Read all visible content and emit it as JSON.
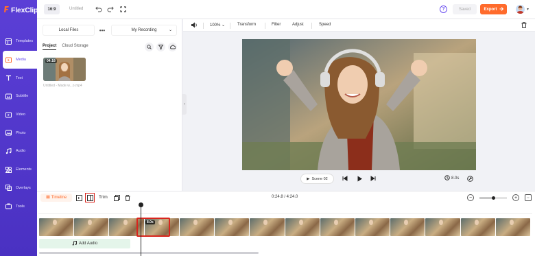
{
  "app": {
    "logo": "FlexClip"
  },
  "topbar": {
    "ratio": "16:9",
    "title": "Untitled",
    "saved": "Saved",
    "export": "Export",
    "help": "?"
  },
  "sidebar": {
    "items": [
      {
        "label": "Templates",
        "icon": "templates-icon"
      },
      {
        "label": "Media",
        "icon": "media-icon",
        "active": true
      },
      {
        "label": "Text",
        "icon": "text-icon"
      },
      {
        "label": "Subtitle",
        "icon": "subtitle-icon"
      },
      {
        "label": "Video",
        "icon": "video-icon"
      },
      {
        "label": "Photo",
        "icon": "photo-icon"
      },
      {
        "label": "Audio",
        "icon": "audio-icon"
      },
      {
        "label": "Elements",
        "icon": "elements-icon"
      },
      {
        "label": "Overlays",
        "icon": "overlays-icon"
      },
      {
        "label": "Tools",
        "icon": "tools-icon"
      }
    ]
  },
  "panel": {
    "local_files": "Local Files",
    "more": "•••",
    "my_recording": "My Recording",
    "tabs": [
      "Project",
      "Cloud Storage"
    ],
    "media": [
      {
        "duration": "04:18",
        "name": "Untitled - Made w...o.mp4"
      }
    ]
  },
  "editor_toolbar": {
    "zoom": "100%",
    "transform": "Transform",
    "filter": "Filter",
    "adjust": "Adjust",
    "speed": "Speed"
  },
  "player": {
    "scene": "Scene 02",
    "speed": "8.0s"
  },
  "timeline": {
    "label": "Timeline",
    "trim": "Trim",
    "time": "0:24.8 / 4:24.0",
    "zoom_level": 0.5,
    "clip_duration": "8.0s",
    "add_audio": "Add Audio"
  },
  "colors": {
    "brand": "#5b3fd6",
    "accent": "#ff6b2c",
    "highlight": "#d9251d"
  }
}
